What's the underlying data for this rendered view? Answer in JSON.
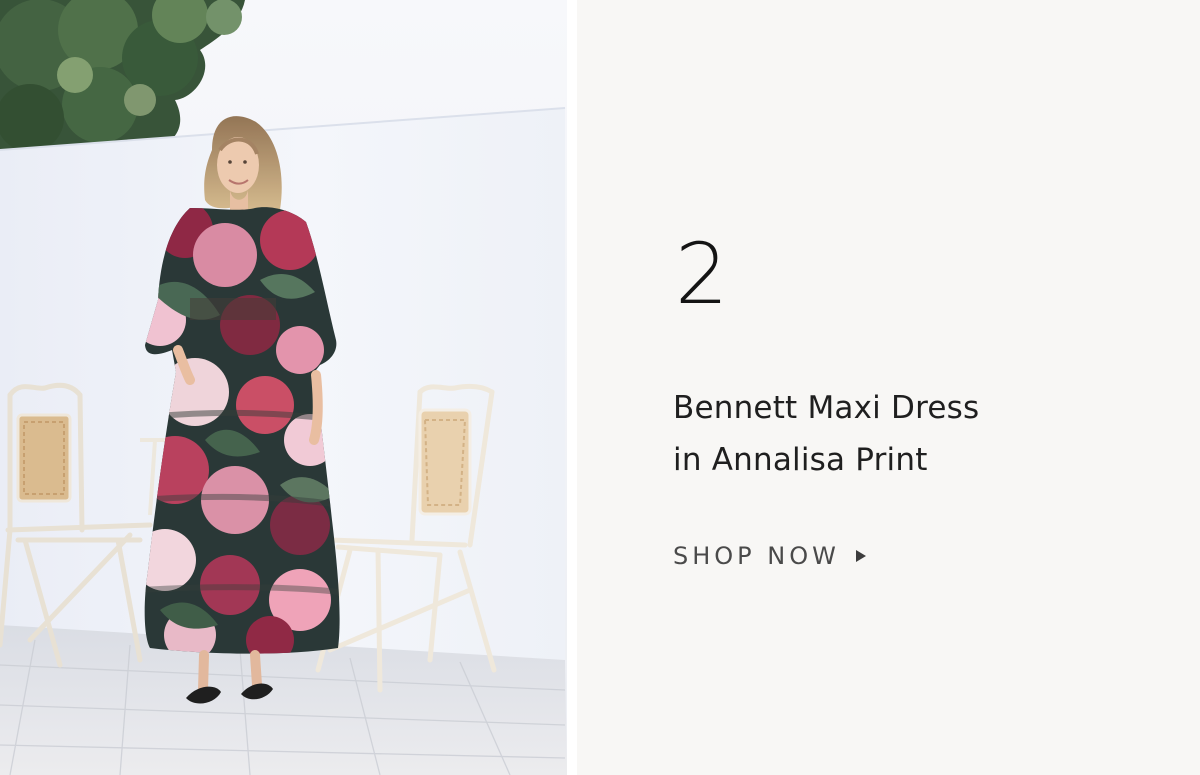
{
  "hero": {
    "image": {
      "alt": "Woman in a long floral maxi dress standing between two white garden chairs against a white wall"
    }
  },
  "product": {
    "number": "2",
    "title_line_1": "Bennett Maxi Dress",
    "title_line_2": "in Annalisa Print",
    "cta_label": "SHOP NOW",
    "cta_icon": "play-arrow-icon"
  },
  "colors": {
    "panel_background": "#f8f7f5",
    "text_primary": "#1f1f1f",
    "text_secondary": "#4a4a4a"
  }
}
